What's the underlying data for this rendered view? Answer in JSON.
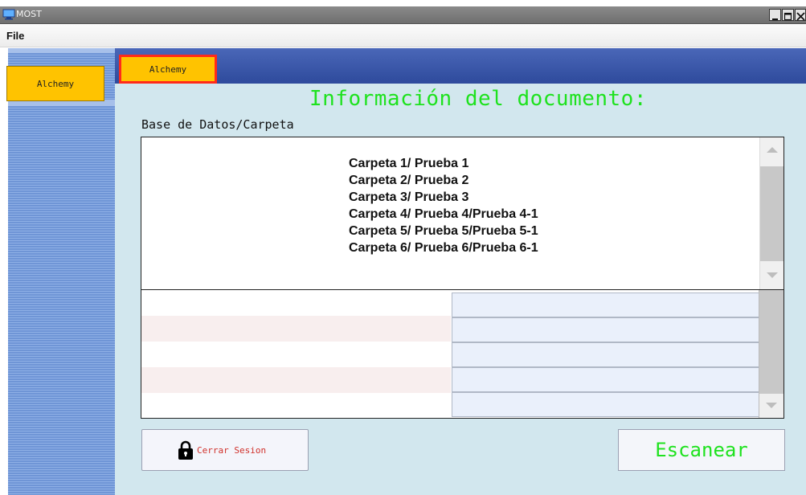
{
  "window": {
    "title": "MOST"
  },
  "menubar": {
    "file": "File"
  },
  "sidebar": {
    "items": [
      {
        "label": "Alchemy"
      }
    ]
  },
  "tabs": [
    {
      "label": "Alchemy",
      "selected": true
    }
  ],
  "document": {
    "title": "Información del documento:",
    "db_label": "Base de Datos/Carpeta",
    "folders": [
      "Carpeta 1/ Prueba 1",
      "Carpeta 2/ Prueba 2",
      "Carpeta 3/ Prueba 3",
      "Carpeta 4/ Prueba 4/Prueba 4-1",
      "Carpeta 5/ Prueba 5/Prueba 5-1",
      "Carpeta 6/ Prueba 6/Prueba 6-1"
    ],
    "fields": [
      {
        "label": "",
        "value": ""
      },
      {
        "label": "",
        "value": ""
      },
      {
        "label": "",
        "value": ""
      },
      {
        "label": "",
        "value": ""
      },
      {
        "label": "",
        "value": ""
      }
    ]
  },
  "actions": {
    "logout_label": "Cerrar Sesion",
    "scan_label": "Escanear"
  },
  "colors": {
    "accent_green": "#1ee21e",
    "tab_yellow": "#ffc300",
    "tab_border_red": "#ff2a1a",
    "header_blue": "#3a58aa",
    "panel_bg": "#d2e7ee",
    "logout_red": "#d0302a"
  },
  "icons": {
    "app": "monitor-icon",
    "logout": "lock-icon"
  }
}
